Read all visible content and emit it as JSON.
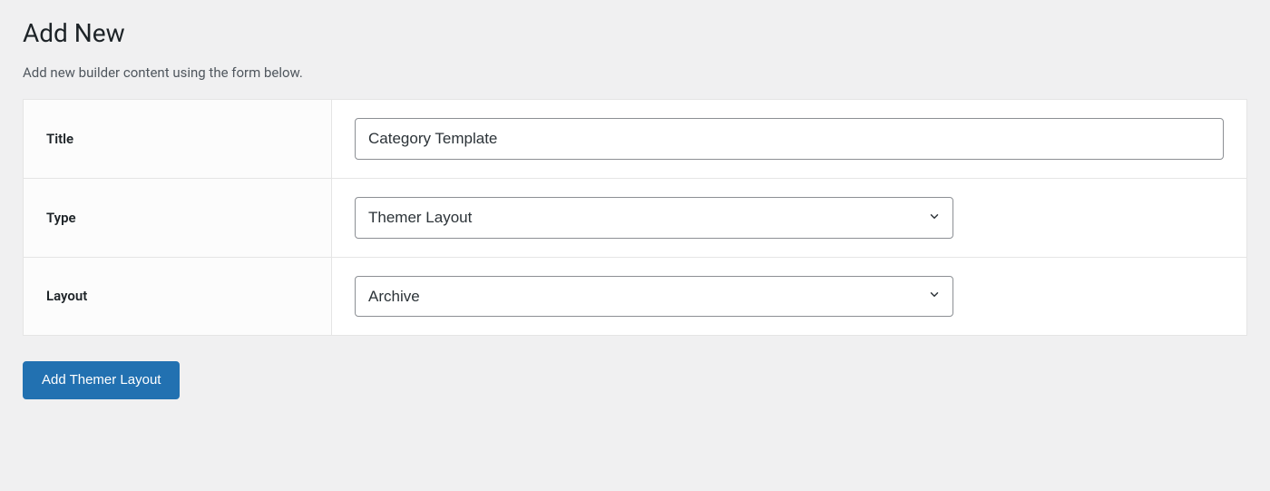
{
  "page": {
    "title": "Add New",
    "description": "Add new builder content using the form below."
  },
  "form": {
    "title": {
      "label": "Title",
      "value": "Category Template"
    },
    "type": {
      "label": "Type",
      "value": "Themer Layout"
    },
    "layout": {
      "label": "Layout",
      "value": "Archive"
    },
    "submit": {
      "label": "Add Themer Layout"
    }
  }
}
